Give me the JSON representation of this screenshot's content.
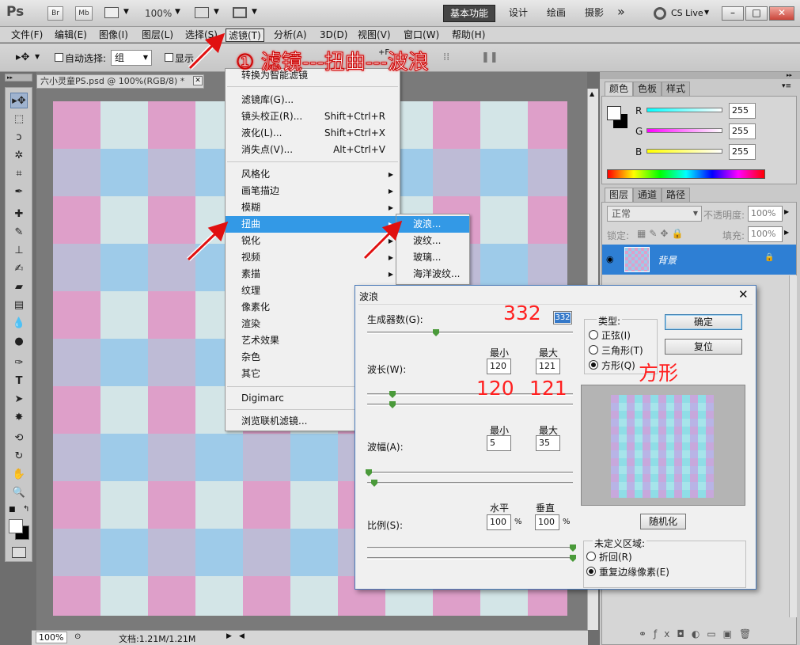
{
  "app": {
    "logo": "Ps",
    "br": "Br",
    "mb": "Mb",
    "zoom": "100%"
  },
  "workspaces": {
    "essentials": "基本功能",
    "design": "设计",
    "painting": "绘画",
    "photo": "摄影",
    "more": "»",
    "cslive": "CS Live"
  },
  "window_controls": {
    "minimize": "–",
    "restore": "□",
    "close": "✕"
  },
  "menubar": [
    "文件(F)",
    "编辑(E)",
    "图像(I)",
    "图层(L)",
    "选择(S)",
    "滤镜(T)",
    "分析(A)",
    "3D(D)",
    "视图(V)",
    "窗口(W)",
    "帮助(H)"
  ],
  "options": {
    "auto_select": "自动选择:",
    "auto_select_value": "组",
    "show_label": "显示",
    "shortcut_hint": "+F"
  },
  "document": {
    "tab_title": "六小灵童PS.psd @ 100%(RGB/8) *",
    "zoom": "100%",
    "file_info": "文档:1.21M/1.21M"
  },
  "filter_menu": {
    "top_item": "转换为智能滤镜",
    "items": [
      {
        "label": "滤镜库(G)...",
        "shortcut": ""
      },
      {
        "label": "镜头校正(R)...",
        "shortcut": "Shift+Ctrl+R"
      },
      {
        "label": "液化(L)...",
        "shortcut": "Shift+Ctrl+X"
      },
      {
        "label": "消失点(V)...",
        "shortcut": "Alt+Ctrl+V"
      }
    ],
    "submenus": [
      "风格化",
      "画笔描边",
      "模糊",
      "扭曲",
      "锐化",
      "视频",
      "素描",
      "纹理",
      "像素化",
      "渲染",
      "艺术效果",
      "杂色",
      "其它"
    ],
    "digimarc": "Digimarc",
    "browse": "浏览联机滤镜..."
  },
  "distort_submenu": [
    "波浪...",
    "波纹...",
    "玻璃...",
    "海洋波纹..."
  ],
  "annotations": {
    "step": "① 滤镜---扭曲---波浪",
    "generators": "332",
    "wavelength_min": "120",
    "wavelength_max": "121",
    "type": "方形"
  },
  "wave_dialog": {
    "title": "波浪",
    "generators_label": "生成器数(G):",
    "generators_value": "332",
    "min_label": "最小",
    "max_label": "最大",
    "wavelength_label": "波长(W):",
    "wavelength_min": "120",
    "wavelength_max": "121",
    "amplitude_label": "波幅(A):",
    "amplitude_min": "5",
    "amplitude_max": "35",
    "scale_label": "比例(S):",
    "horizontal_label": "水平",
    "vertical_label": "垂直",
    "scale_h": "100",
    "scale_v": "100",
    "percent": "%",
    "type_label": "类型:",
    "types": [
      "正弦(I)",
      "三角形(T)",
      "方形(Q)"
    ],
    "type_selected": 2,
    "ok": "确定",
    "reset": "复位",
    "randomize": "随机化",
    "undefined_label": "未定义区域:",
    "undefined_options": [
      "折回(R)",
      "重复边缘像素(E)"
    ],
    "undefined_selected": 1,
    "close": "✕"
  },
  "color_panel": {
    "tabs": [
      "颜色",
      "色板",
      "样式"
    ],
    "r_label": "R",
    "g_label": "G",
    "b_label": "B",
    "r": "255",
    "g": "255",
    "b": "255"
  },
  "layers_panel": {
    "tabs": [
      "图层",
      "通道",
      "路径"
    ],
    "blend": "正常",
    "opacity_label": "不透明度:",
    "opacity": "100%",
    "lock_label": "锁定:",
    "fill_label": "填充:",
    "fill": "100%",
    "layer_name": "背景"
  },
  "canvas_colors": {
    "pink": "#de9fc9",
    "lavender": "#bebbd6",
    "lightblue": "#9ecbe9",
    "pale": "#d3e5e7"
  }
}
